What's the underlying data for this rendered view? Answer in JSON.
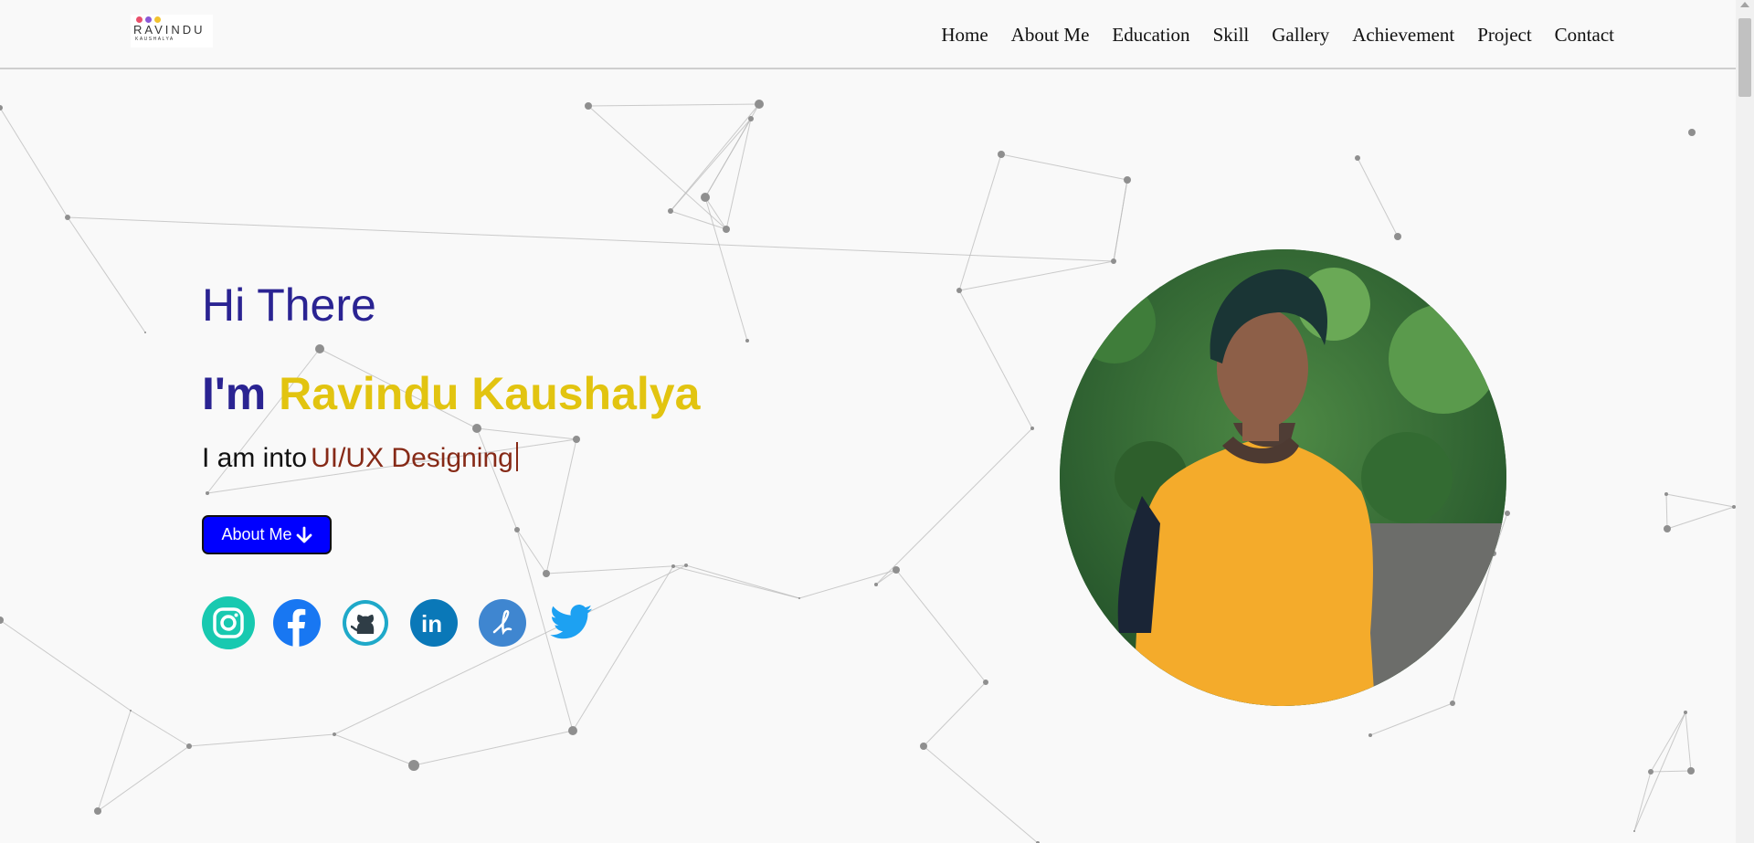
{
  "logo": {
    "name": "RAVINDU",
    "sub": "KAUSHALYA",
    "dot_colors": [
      "#e94f6b",
      "#8a58d6",
      "#f2c230"
    ]
  },
  "nav": {
    "items": [
      "Home",
      "About Me",
      "Education",
      "Skill",
      "Gallery",
      "Achievement",
      "Project",
      "Contact"
    ]
  },
  "hero": {
    "greeting": "Hi There",
    "iam_prefix": "I'm",
    "name": "Ravindu Kaushalya",
    "into_prefix": "I am into",
    "role": "UI/UX Designing",
    "about_button": "About Me",
    "about_icon": "arrow-down-icon"
  },
  "social": {
    "icons": [
      "instagram-icon",
      "facebook-icon",
      "github-icon",
      "linkedin-icon",
      "dribbble-icon",
      "twitter-icon"
    ]
  },
  "colors": {
    "accent_blue": "#2a2392",
    "name_yellow": "#e2c410",
    "role_brown": "#862a17",
    "button_blue": "#0000ff",
    "background": "#f9f9f9"
  }
}
